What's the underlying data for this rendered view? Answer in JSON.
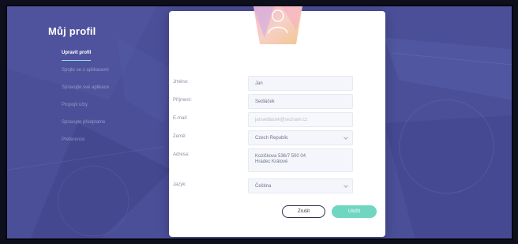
{
  "sidebar": {
    "title": "Můj profil",
    "items": [
      {
        "label": "Upravit profil",
        "active": true
      },
      {
        "label": "Spojte se s aplikacemi",
        "active": false
      },
      {
        "label": "Spravujte své aplikace",
        "active": false
      },
      {
        "label": "Propojit účty",
        "active": false
      },
      {
        "label": "Spravujte předplatné",
        "active": false
      },
      {
        "label": "Preference",
        "active": false
      }
    ]
  },
  "profile": {
    "avatar_icon": "user-icon",
    "fields": {
      "first_name": {
        "label": "Jméno:",
        "value": "Jan"
      },
      "last_name": {
        "label": "Příjmení:",
        "value": "Sedláček"
      },
      "email": {
        "label": "E-mail:",
        "value": "jansedlacek@seznam.cz"
      },
      "country": {
        "label": "Země:",
        "value": "Czech Republic"
      },
      "address": {
        "label": "Adresa:",
        "line1": "Kozičkova 536/7 500 04",
        "line2": "Hradec Králové"
      },
      "language": {
        "label": "Jazyk:",
        "value": "Čeština"
      }
    },
    "buttons": {
      "cancel": "Zrušit",
      "save": "Uložit"
    }
  },
  "colors": {
    "background": "#4a4f98",
    "accent": "#6fd6c2",
    "active_underline": "#8ee3e8"
  }
}
